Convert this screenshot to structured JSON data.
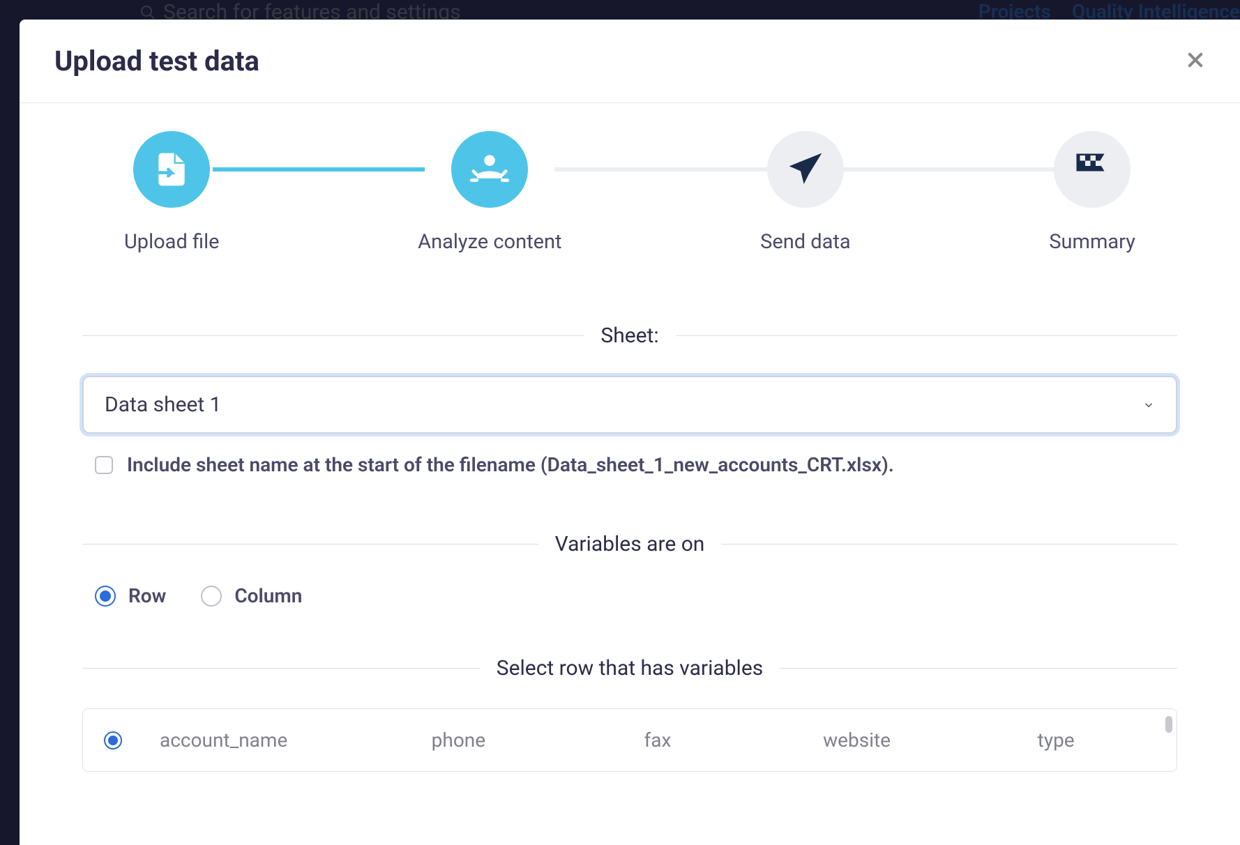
{
  "background": {
    "search_placeholder": "Search for features and settings",
    "nav": {
      "projects": "Projects",
      "quality": "Quality Intelligence"
    }
  },
  "modal": {
    "title": "Upload test data",
    "steps": [
      {
        "label": "Upload file",
        "state": "active"
      },
      {
        "label": "Analyze content",
        "state": "active"
      },
      {
        "label": "Send data",
        "state": "inactive"
      },
      {
        "label": "Summary",
        "state": "inactive"
      }
    ],
    "sheet": {
      "label": "Sheet:",
      "selected": "Data sheet 1",
      "include_name_label": "Include sheet name at the start of the filename (Data_sheet_1_new_accounts_CRT.xlsx)."
    },
    "variables_on": {
      "label": "Variables are on",
      "options": {
        "row": "Row",
        "column": "Column"
      },
      "selected": "row"
    },
    "select_row": {
      "label": "Select row that has variables",
      "rows": [
        {
          "selected": true,
          "cells": [
            "account_name",
            "phone",
            "fax",
            "website",
            "type"
          ]
        }
      ]
    }
  }
}
